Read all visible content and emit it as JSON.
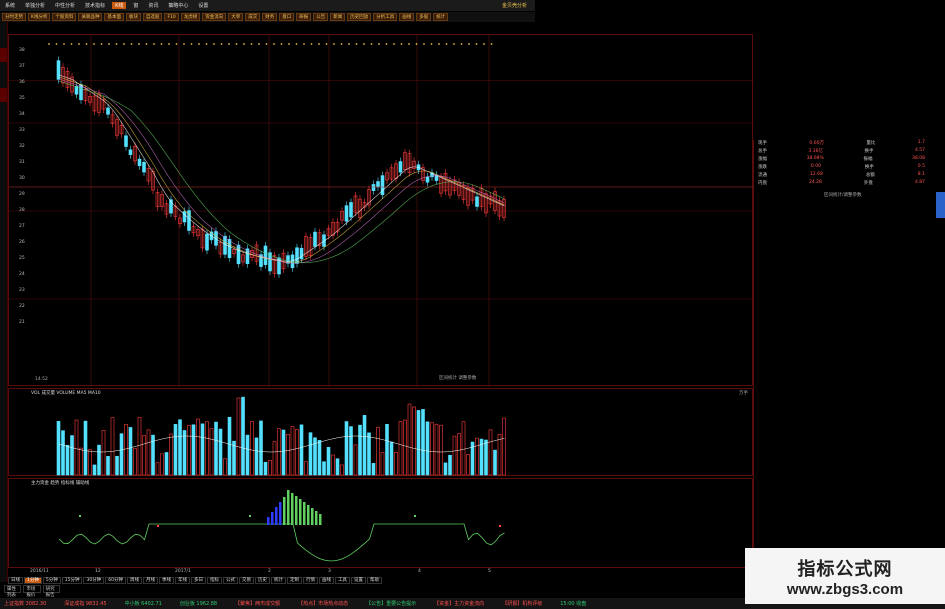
{
  "menubar": {
    "items": [
      "系统",
      "单独分析",
      "中性分析",
      "技术指标",
      "K线",
      "窗",
      "资讯",
      "策略中心",
      "设置"
    ],
    "active_index": 4,
    "brand": "金贝壳分析"
  },
  "toolbar": {
    "items": [
      "分时走势",
      "K线分析",
      "个股资料",
      "关联品种",
      "基本面",
      "板块",
      "自选股",
      "F10",
      "龙虎榜",
      "资金流向",
      "大单",
      "成交",
      "财务",
      "盘口",
      "研报",
      "公告",
      "新闻",
      "历史回放",
      "分析工具",
      "画线",
      "多股",
      "统计"
    ]
  },
  "main_chart": {
    "price_ticks": [
      "38",
      "37",
      "36",
      "35",
      "34",
      "33",
      "32",
      "31",
      "30",
      "29",
      "28",
      "27",
      "26",
      "25",
      "24",
      "23",
      "22",
      "21"
    ],
    "corner_note": "区间统计 调整参数",
    "bottom_left_value": "14.52"
  },
  "volume_chart": {
    "header": "VOL   成交量 VOLUME  MA5  MA10",
    "right_label": "万手"
  },
  "indicator_chart": {
    "header": "主力资金 趋势  指标线  辅助线"
  },
  "date_axis": {
    "labels": [
      "2016/11",
      "12",
      "2017/1",
      "2",
      "3",
      "4",
      "5"
    ]
  },
  "bottom_tabs": {
    "items": [
      "日线",
      "1分钟",
      "5分钟",
      "15分钟",
      "30分钟",
      "60分钟",
      "周线",
      "月线",
      "季线",
      "年线",
      "多日",
      "指标",
      "公式",
      "交易",
      "历史",
      "统计",
      "定制",
      "行情",
      "画线",
      "工具",
      "设置",
      "帮助"
    ],
    "selected_index": 1
  },
  "bottom_tabs2": {
    "items": [
      "属性列表",
      "市场报价",
      "研究报告"
    ]
  },
  "info_panel": {
    "rows": [
      {
        "label": "现手",
        "value": "0.60万",
        "label2": "量比",
        "value2": "1.7"
      },
      {
        "label": "总手",
        "value": "3.36亿",
        "label2": "换手",
        "value2": "4.57"
      },
      {
        "label": "涨幅",
        "value": "38.08%",
        "label2": "振幅",
        "value2": "38.08"
      },
      {
        "label": "涨跌",
        "value": "0.00",
        "label2": "换手",
        "value2": "0.5"
      },
      {
        "label": "流通",
        "value": "12.68",
        "label2": "总额",
        "value2": "8.1"
      },
      {
        "label": "内盘",
        "value": "24.28",
        "label2": "外盘",
        "value2": "4.87"
      }
    ],
    "note": "区间统计/调整参数"
  },
  "statusbar": {
    "items": [
      {
        "text": "上证指数 3082.30",
        "dir": "up"
      },
      {
        "text": "深证成指 9832.45",
        "dir": "up"
      },
      {
        "text": "中小板 6402.71",
        "dir": "down"
      },
      {
        "text": "创业板 1962.88",
        "dir": "down"
      },
      {
        "text": "【聚焦】两市成交额",
        "dir": "up"
      },
      {
        "text": "【热点】市场热点动态",
        "dir": "up"
      },
      {
        "text": "【公告】重要公告提示",
        "dir": "down"
      },
      {
        "text": "【资金】主力资金流向",
        "dir": "up"
      },
      {
        "text": "【研报】机构评级",
        "dir": "up"
      },
      {
        "text": "15:00 收盘",
        "dir": "down"
      }
    ]
  },
  "watermark": {
    "title": "指标公式网",
    "url": "www.zbgs3.com"
  },
  "colors": {
    "up": "#ff3b3b",
    "down": "#54e1ff",
    "ma1": "#ffffff",
    "ma2": "#e8c547",
    "ma3": "#d070d0",
    "ma4": "#60d060",
    "grid": "#5a0d0d",
    "indicator_line": "#60d060"
  }
}
